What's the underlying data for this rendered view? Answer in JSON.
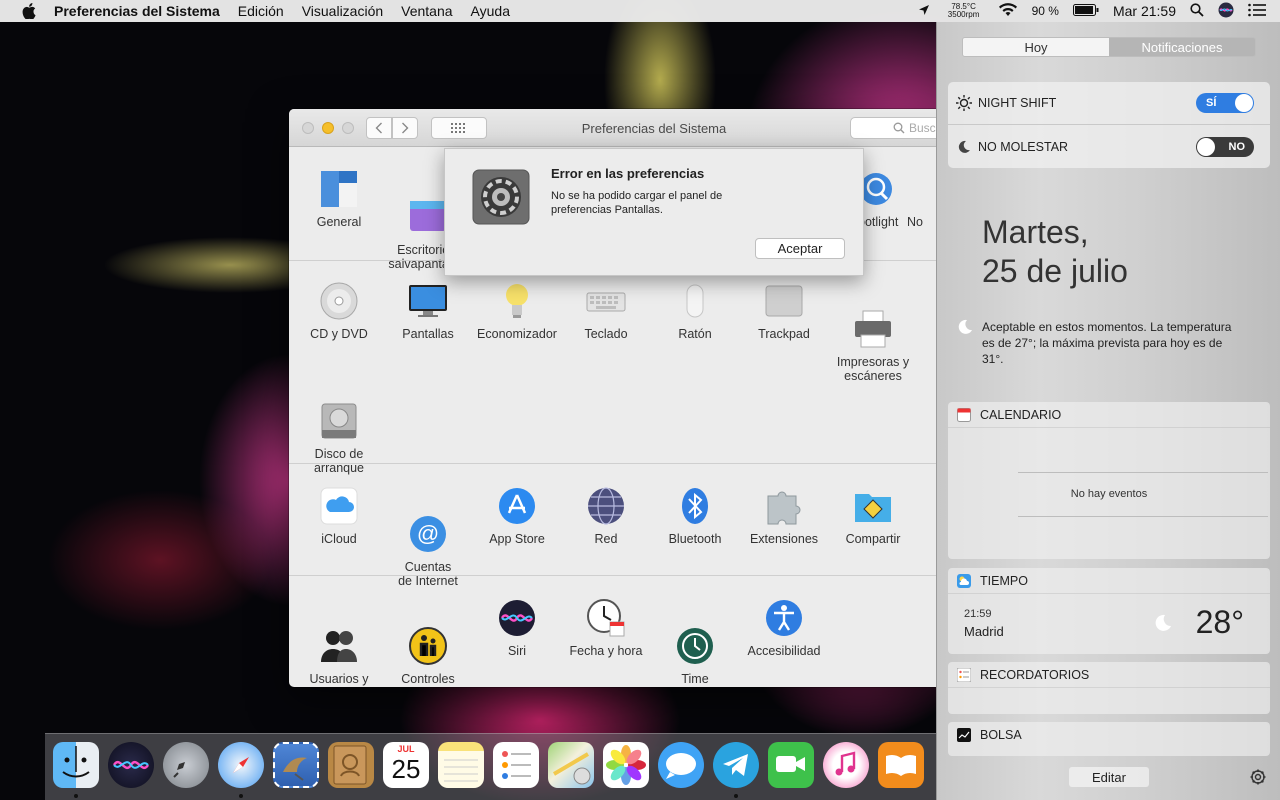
{
  "menubar": {
    "app_name": "Preferencias del Sistema",
    "menus": [
      "Edición",
      "Visualización",
      "Ventana",
      "Ayuda"
    ],
    "temp_line1": "78.5°C",
    "temp_line2": "3500rpm",
    "battery": "90 %",
    "clock": "Mar 21:59"
  },
  "window": {
    "title": "Preferencias del Sistema",
    "search_placeholder": "Busc"
  },
  "prefs": {
    "row1": [
      "General",
      "Escritorio y\nsalvapantallas",
      "Spotlight",
      "No"
    ],
    "row2": [
      "CD y DVD",
      "Pantallas",
      "Economizador",
      "Teclado",
      "Ratón",
      "Trackpad",
      "Impresoras y\nescáneres"
    ],
    "row3": [
      "Disco de\narranque"
    ],
    "row4": [
      "iCloud",
      "Cuentas\nde Internet",
      "App Store",
      "Red",
      "Bluetooth",
      "Extensiones",
      "Compartir"
    ],
    "row5": [
      "Usuarios y\ngrupos",
      "Controles\nparentales",
      "Siri",
      "Fecha y hora",
      "Time\nMachine",
      "Accesibilidad"
    ]
  },
  "error_sheet": {
    "title": "Error en las preferencias",
    "message": "No se ha podido cargar el panel de preferencias Pantallas.",
    "ok_label": "Aceptar"
  },
  "notification_center": {
    "tabs": [
      "Hoy",
      "Notificaciones"
    ],
    "night_shift": {
      "label": "NIGHT SHIFT",
      "state": "SÍ"
    },
    "do_not_disturb": {
      "label": "NO MOLESTAR",
      "state": "NO"
    },
    "date_line1": "Martes,",
    "date_line2": "25 de julio",
    "weather_summary": "Aceptable en estos momentos. La temperatura es de 27°; la máxima prevista para hoy es de 31°.",
    "calendar": {
      "title": "CALENDARIO",
      "empty": "No hay eventos"
    },
    "weather": {
      "title": "TIEMPO",
      "time": "21:59",
      "city": "Madrid",
      "temp": "28°"
    },
    "reminders": {
      "title": "RECORDATORIOS"
    },
    "stocks": {
      "title": "BOLSA"
    },
    "edit_label": "Editar"
  },
  "dock": {
    "apps": [
      "Finder",
      "Siri",
      "Launchpad",
      "Safari",
      "Correo",
      "Contactos",
      "Calendario",
      "Notas",
      "Recordatorios",
      "Mapas",
      "Fotos",
      "Mensajes",
      "Telegram",
      "FaceTime",
      "iTunes",
      "iBooks"
    ],
    "calendar_month": "JUL",
    "calendar_day": "25"
  },
  "colors": {
    "accent_blue": "#2f7de1",
    "minimize_yellow": "#f5bf2a"
  }
}
